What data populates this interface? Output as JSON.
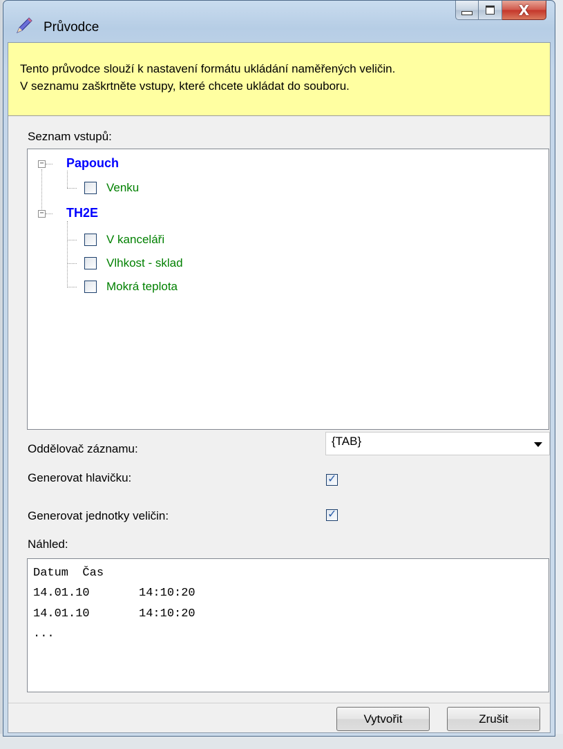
{
  "window": {
    "title": "Průvodce",
    "icon": "pen-icon"
  },
  "banner": {
    "line1": "Tento průvodce slouží k nastavení formátu ukládání naměřených veličin.",
    "line2": "V seznamu zaškrtněte vstupy, které chcete ukládat do souboru."
  },
  "inputs": {
    "label": "Seznam vstupů:",
    "groups": [
      {
        "name": "Papouch",
        "expanded": true,
        "items": [
          {
            "label": "Venku",
            "checked": false
          }
        ]
      },
      {
        "name": "TH2E",
        "expanded": true,
        "items": [
          {
            "label": "V kanceláři",
            "checked": false
          },
          {
            "label": "Vlhkost - sklad",
            "checked": false
          },
          {
            "label": "Mokrá teplota",
            "checked": false
          }
        ]
      }
    ]
  },
  "settings": {
    "separator_label": "Oddělovač záznamu:",
    "separator_value": "{TAB}",
    "header_label": "Generovat hlavičku:",
    "header_checked": true,
    "units_label": "Generovat jednotky veličin:",
    "units_checked": true
  },
  "preview": {
    "label": "Náhled:",
    "lines": [
      "Datum  Čas",
      "14.01.10       14:10:20",
      "14.01.10       14:10:20",
      "..."
    ]
  },
  "buttons": {
    "create": "Vytvořit",
    "cancel": "Zrušit"
  },
  "colors": {
    "banner_bg": "#ffffa1",
    "group_text": "#0000ff",
    "item_text": "#008000"
  }
}
